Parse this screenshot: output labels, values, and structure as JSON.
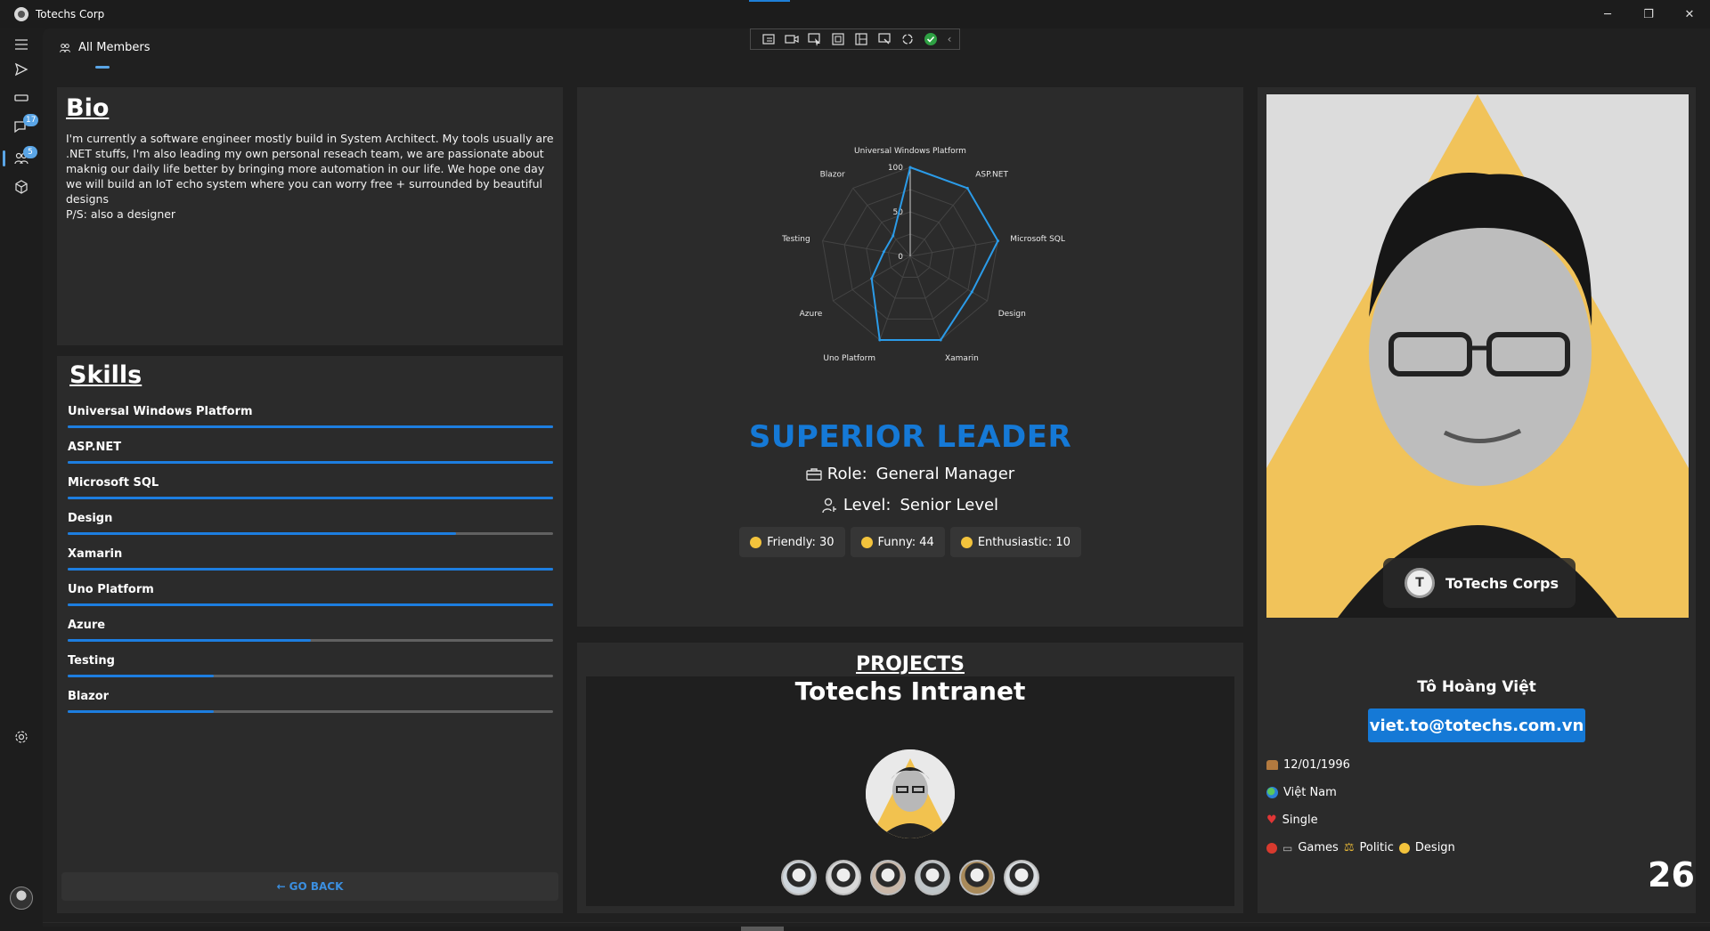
{
  "window": {
    "title": "Totechs Corp",
    "minimize": "─",
    "maximize": "❐",
    "close": "✕"
  },
  "tab": {
    "label": "All Members"
  },
  "sidebar": {
    "messages_badge": "17",
    "members_badge": "5"
  },
  "bio": {
    "title": "Bio",
    "text": "I'm currently a software engineer mostly build in System Architect. My tools usually are .NET stuffs, I'm also leading my own personal reseach team, we are passionate about maknig our daily life better by bringing more automation in our life. We hope one day we will build an IoT echo system where you can worry free + surrounded by beautiful designs\nP/S: also a designer"
  },
  "skills": {
    "title": "Skills",
    "items": [
      {
        "name": "Universal Windows Platform",
        "value": 100
      },
      {
        "name": "ASP.NET",
        "value": 100
      },
      {
        "name": "Microsoft SQL",
        "value": 100
      },
      {
        "name": "Design",
        "value": 80
      },
      {
        "name": "Xamarin",
        "value": 100
      },
      {
        "name": "Uno Platform",
        "value": 100
      },
      {
        "name": "Azure",
        "value": 50
      },
      {
        "name": "Testing",
        "value": 30
      },
      {
        "name": "Blazor",
        "value": 30
      }
    ],
    "go_back": "GO BACK"
  },
  "chart_data": {
    "type": "radar",
    "categories": [
      "Universal Windows Platform",
      "ASP.NET",
      "Microsoft SQL",
      "Design",
      "Xamarin",
      "Uno Platform",
      "Azure",
      "Testing",
      "Blazor"
    ],
    "values": [
      100,
      100,
      100,
      80,
      100,
      100,
      50,
      30,
      30
    ],
    "ticks": [
      "0",
      "50",
      "100"
    ],
    "rlim": [
      0,
      100
    ],
    "series_color": "#2b9be8"
  },
  "leader": {
    "title": "SUPERIOR LEADER",
    "role_label": "Role:",
    "role_value": "General Manager",
    "level_label": "Level:",
    "level_value": "Senior Level",
    "traits": [
      {
        "label": "Friendly: 30"
      },
      {
        "label": "Funny:  44"
      },
      {
        "label": "Enthusiastic: 10"
      }
    ]
  },
  "projects": {
    "title": "PROJECTS",
    "name": "Totechs Intranet",
    "member_count": 6
  },
  "profile": {
    "company": "ToTechs Corps",
    "name": "Tô Hoàng Việt",
    "email": "viet.to@totechs.com.vn",
    "dob": "12/01/1996",
    "country": "Việt Nam",
    "status": "Single",
    "hobbies": [
      "Games",
      "Politic",
      "Design"
    ],
    "age": "26"
  },
  "colors": {
    "accent": "#1579d6",
    "badge": "#5aa5e6",
    "card": "#2b2b2b"
  }
}
